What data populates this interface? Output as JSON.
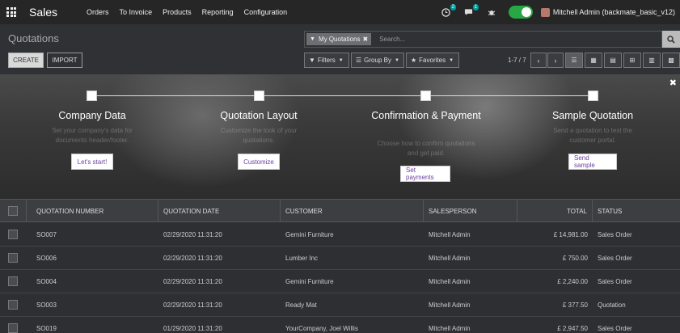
{
  "navbar": {
    "brand": "Sales",
    "menu": [
      "Orders",
      "To Invoice",
      "Products",
      "Reporting",
      "Configuration"
    ],
    "activity_badge": "2",
    "messages_badge": "1",
    "user": "Mitchell Admin (backmate_basic_v12)"
  },
  "control_panel": {
    "title": "Quotations",
    "create_label": "CREATE",
    "import_label": "IMPORT",
    "facet_label": "My Quotations",
    "search_placeholder": "Search...",
    "filters_label": "Filters",
    "groupby_label": "Group By",
    "favorites_label": "Favorites",
    "pager": "1-7 / 7"
  },
  "banner": {
    "steps": [
      {
        "title": "Company Data",
        "desc": "Set your company's data for documents header/footer.",
        "button": "Let's start!"
      },
      {
        "title": "Quotation Layout",
        "desc": "Customize the look of your quotations.",
        "button": "Customize"
      },
      {
        "title": "Confirmation & Payment",
        "desc": "Choose how to confirm quotations and get paid.",
        "button": "Set payments"
      },
      {
        "title": "Sample Quotation",
        "desc": "Send a quotation to test the customer portal.",
        "button": "Send sample"
      }
    ]
  },
  "table": {
    "headers": [
      "QUOTATION NUMBER",
      "QUOTATION DATE",
      "CUSTOMER",
      "SALESPERSON",
      "TOTAL",
      "STATUS"
    ],
    "rows": [
      [
        "SO007",
        "02/29/2020 11:31:20",
        "Gemini Furniture",
        "Mitchell Admin",
        "£ 14,981.00",
        "Sales Order"
      ],
      [
        "SO006",
        "02/29/2020 11:31:20",
        "Lumber Inc",
        "Mitchell Admin",
        "£ 750.00",
        "Sales Order"
      ],
      [
        "SO004",
        "02/29/2020 11:31:20",
        "Gemini Furniture",
        "Mitchell Admin",
        "£ 2,240.00",
        "Sales Order"
      ],
      [
        "SO003",
        "02/29/2020 11:31:20",
        "Ready Mat",
        "Mitchell Admin",
        "£ 377.50",
        "Quotation"
      ],
      [
        "SO019",
        "01/29/2020 11:31:20",
        "YourCompany, Joel Willis",
        "Mitchell Admin",
        "£ 2,947.50",
        "Sales Order"
      ]
    ]
  }
}
